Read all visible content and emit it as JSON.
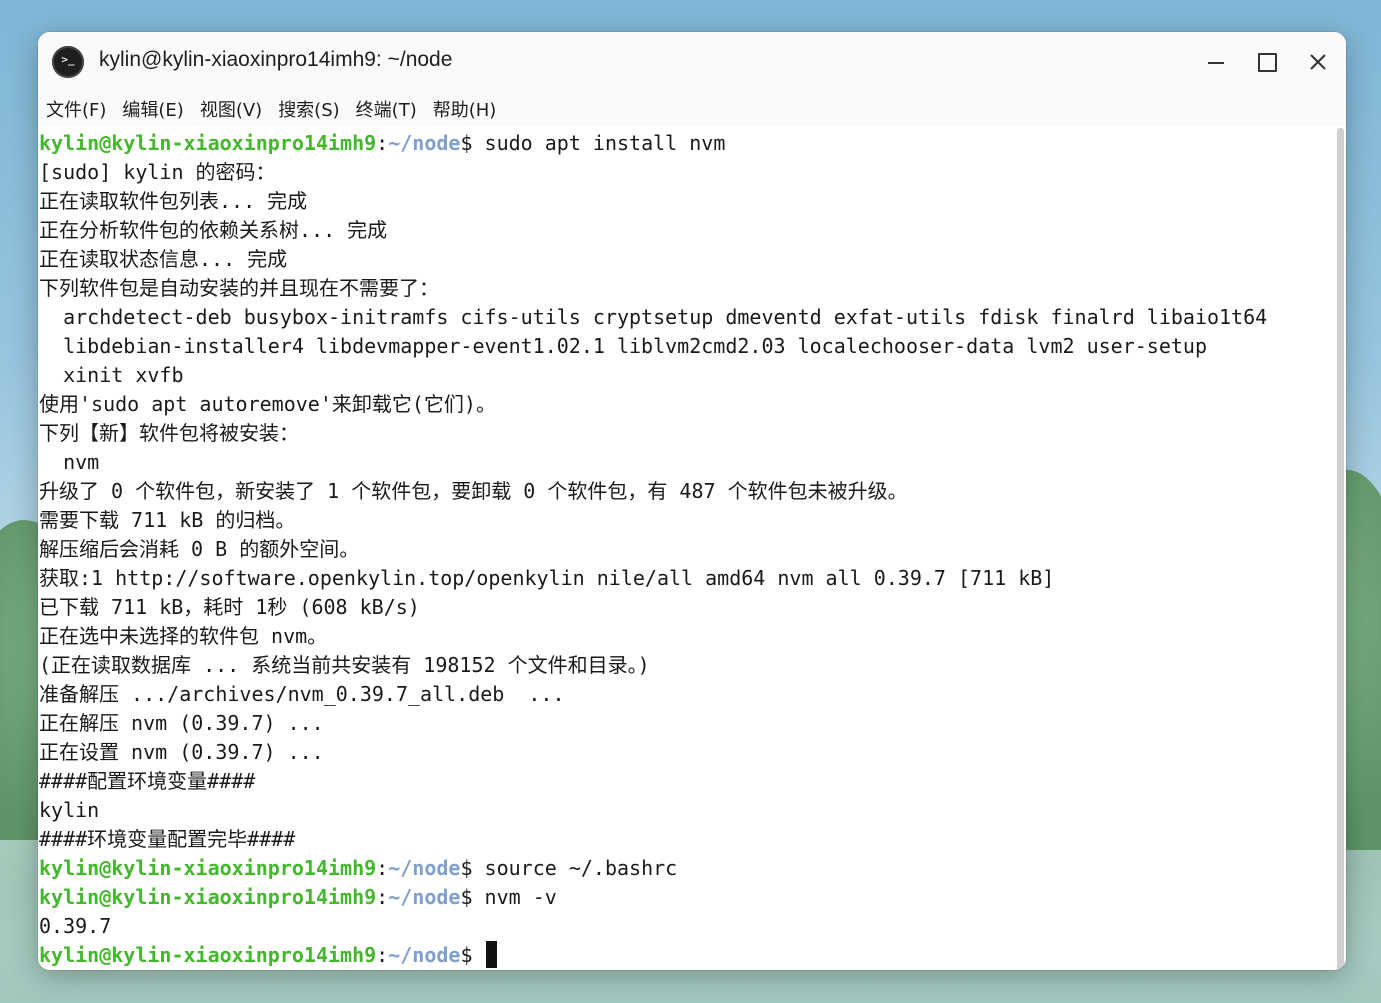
{
  "window": {
    "title": "kylin@kylin-xiaoxinpro14imh9: ~/node",
    "icon": "terminal-icon",
    "icon_glyph": ">_",
    "controls": {
      "minimize": "minimize-icon",
      "maximize": "maximize-icon",
      "close_glyph": "✕"
    }
  },
  "menu": {
    "items": [
      {
        "label": "文件(F)"
      },
      {
        "label": "编辑(E)"
      },
      {
        "label": "视图(V)"
      },
      {
        "label": "搜索(S)"
      },
      {
        "label": "终端(T)"
      },
      {
        "label": "帮助(H)"
      }
    ]
  },
  "prompt": {
    "user_host": "kylin@kylin-xiaoxinpro14imh9",
    "colon": ":",
    "path": "~/node",
    "dollar": "$"
  },
  "colors": {
    "prompt_user": "#44b82c",
    "prompt_path": "#7f9fcd",
    "text": "#1a1a1a",
    "background": "#ffffff"
  },
  "terminal": {
    "lines": [
      {
        "type": "cmd",
        "text": "sudo apt install nvm"
      },
      {
        "type": "out",
        "text": "[sudo] kylin 的密码："
      },
      {
        "type": "out",
        "text": "正在读取软件包列表... 完成"
      },
      {
        "type": "out",
        "text": "正在分析软件包的依赖关系树... 完成"
      },
      {
        "type": "out",
        "text": "正在读取状态信息... 完成"
      },
      {
        "type": "out",
        "text": "下列软件包是自动安装的并且现在不需要了："
      },
      {
        "type": "out",
        "text": "  archdetect-deb busybox-initramfs cifs-utils cryptsetup dmeventd exfat-utils fdisk finalrd libaio1t64"
      },
      {
        "type": "out",
        "text": "  libdebian-installer4 libdevmapper-event1.02.1 liblvm2cmd2.03 localechooser-data lvm2 user-setup"
      },
      {
        "type": "out",
        "text": "  xinit xvfb"
      },
      {
        "type": "out",
        "text": "使用'sudo apt autoremove'来卸载它(它们)。"
      },
      {
        "type": "out",
        "text": "下列【新】软件包将被安装："
      },
      {
        "type": "out",
        "text": "  nvm"
      },
      {
        "type": "out",
        "text": "升级了 0 个软件包，新安装了 1 个软件包，要卸载 0 个软件包，有 487 个软件包未被升级。"
      },
      {
        "type": "out",
        "text": "需要下载 711 kB 的归档。"
      },
      {
        "type": "out",
        "text": "解压缩后会消耗 0 B 的额外空间。"
      },
      {
        "type": "out",
        "text": "获取:1 http://software.openkylin.top/openkylin nile/all amd64 nvm all 0.39.7 [711 kB]"
      },
      {
        "type": "out",
        "text": "已下载 711 kB，耗时 1秒 (608 kB/s)"
      },
      {
        "type": "out",
        "text": "正在选中未选择的软件包 nvm。"
      },
      {
        "type": "out",
        "text": "(正在读取数据库 ... 系统当前共安装有 198152 个文件和目录。)"
      },
      {
        "type": "out",
        "text": "准备解压 .../archives/nvm_0.39.7_all.deb  ..."
      },
      {
        "type": "out",
        "text": "正在解压 nvm (0.39.7) ..."
      },
      {
        "type": "out",
        "text": "正在设置 nvm (0.39.7) ..."
      },
      {
        "type": "out",
        "text": "####配置环境变量####"
      },
      {
        "type": "out",
        "text": "kylin"
      },
      {
        "type": "out",
        "text": "####环境变量配置完毕####"
      },
      {
        "type": "cmd",
        "text": "source ~/.bashrc"
      },
      {
        "type": "cmd",
        "text": "nvm -v"
      },
      {
        "type": "out",
        "text": "0.39.7"
      },
      {
        "type": "cmd",
        "text": "",
        "cursor": true
      }
    ]
  }
}
